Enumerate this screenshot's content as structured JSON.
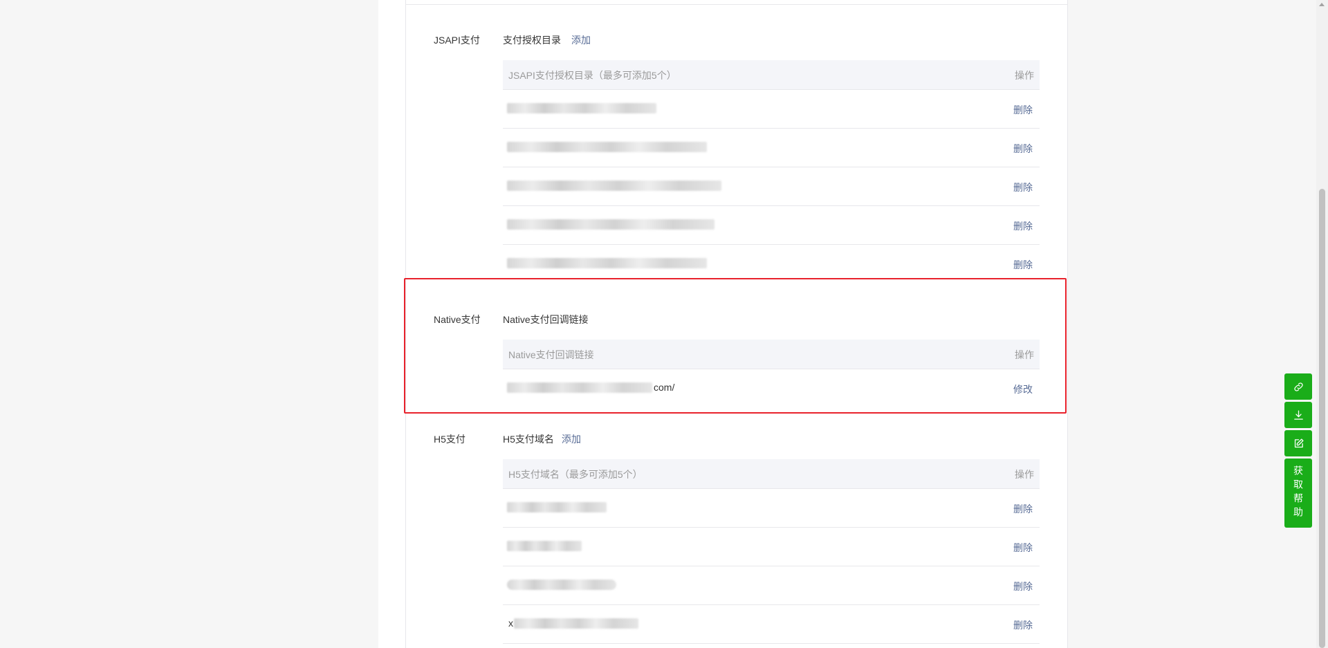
{
  "jsapi": {
    "label": "JSAPI支付",
    "title": "支付授权目录",
    "add_label": "添加",
    "table": {
      "col_name": "JSAPI支付授权目录（最多可添加5个）",
      "col_op": "操作",
      "rows": [
        {
          "op": "删除"
        },
        {
          "op": "删除"
        },
        {
          "op": "删除"
        },
        {
          "op": "删除"
        },
        {
          "op": "删除"
        }
      ]
    }
  },
  "native": {
    "label": "Native支付",
    "title": "Native支付回调链接",
    "table": {
      "col_name": "Native支付回调链接",
      "col_op": "操作",
      "row": {
        "value_suffix": "com/",
        "op": "修改"
      }
    }
  },
  "h5": {
    "label": "H5支付",
    "title": "H5支付域名",
    "add_label": "添加",
    "table": {
      "col_name": "H5支付域名（最多可添加5个）",
      "col_op": "操作",
      "rows": [
        {
          "op": "删除"
        },
        {
          "op": "删除"
        },
        {
          "op": "删除"
        },
        {
          "op": "删除",
          "value_prefix": "x"
        }
      ]
    }
  },
  "side_tools": {
    "link_icon": "link-icon",
    "download_icon": "download-icon",
    "edit_icon": "edit-icon",
    "help_label": "获取帮助"
  },
  "colors": {
    "link": "#576b95",
    "highlight_border": "#e8212b",
    "side_tool_bg": "#1aad19"
  }
}
